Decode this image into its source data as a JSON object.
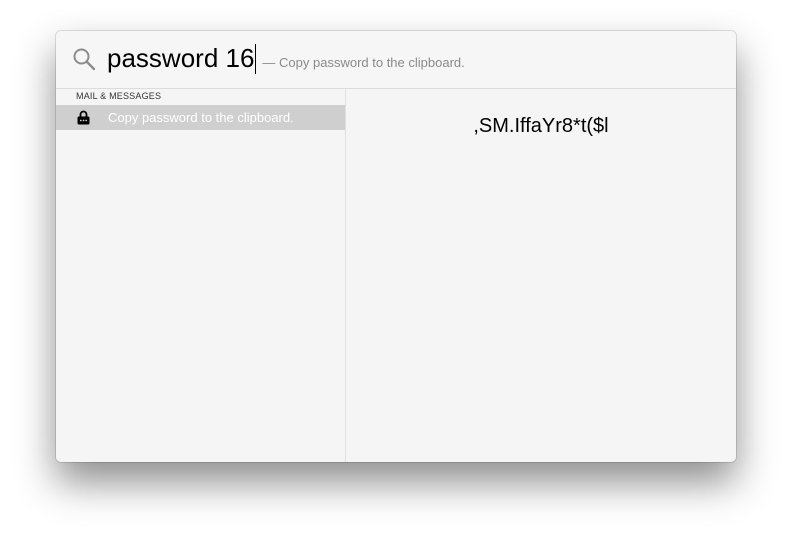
{
  "search": {
    "query": "password 16",
    "hint": "— Copy password to the clipboard.",
    "icon": "search-icon"
  },
  "sidebar": {
    "section_title": "MAIL & MESSAGES",
    "items": [
      {
        "label": "Copy password to the clipboard.",
        "icon": "lock-icon",
        "selected": true
      }
    ]
  },
  "preview": {
    "password": ",SM.IffaYr8*t($l"
  }
}
